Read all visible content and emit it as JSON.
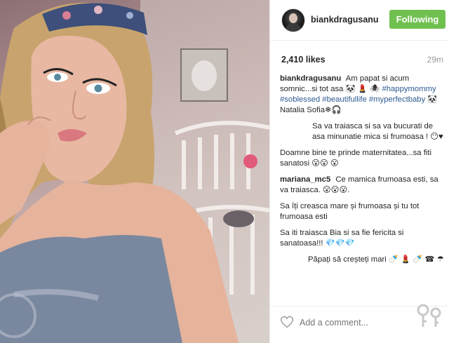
{
  "post": {
    "username": "biankdragusanu",
    "follow_label": "Following",
    "likes": "2,410 likes",
    "time_ago": "29m",
    "add_comment_placeholder": "Add a comment..."
  },
  "comments": [
    {
      "user": "biankdragusanu",
      "text": "Am papat si acum somnic...si tot asa 🐼 💄 🕷",
      "tags": "#happymommy #soblessed #beautifullife #myperfectbaby",
      "tail": "🐼Natalia Sofia❄🎧"
    },
    {
      "user": "",
      "text": "Sa va traiasca si sa va bucurati de asa minunatie mica si frumoasa ! 😶♥"
    },
    {
      "user": "",
      "text": "Doamne bine te prinde maternitatea...sa fiti sanatosi 😮😮 😮"
    },
    {
      "user": "mariana_mc5",
      "text": "Ce mamica frumoasa esti, sa va traiasca. 😮😮😮."
    },
    {
      "user": "",
      "text": "Sa îți creasca mare și frumoasa și tu tot frumoasa esti"
    },
    {
      "user": "",
      "text": "Sa iti traiasca Bia si sa fie fericita si sanatoasa!!! 💎💎💎"
    },
    {
      "user": "",
      "text": "Păpați să creșteți mari 🍼 💄 🍼 ☎ ☂"
    }
  ],
  "icons": {
    "heart": "heart-outline-icon",
    "watermark": "keys-watermark"
  },
  "colors": {
    "follow_bg": "#70c050",
    "hashtag": "#2e5b91",
    "username": "#262626",
    "muted": "#999999"
  }
}
